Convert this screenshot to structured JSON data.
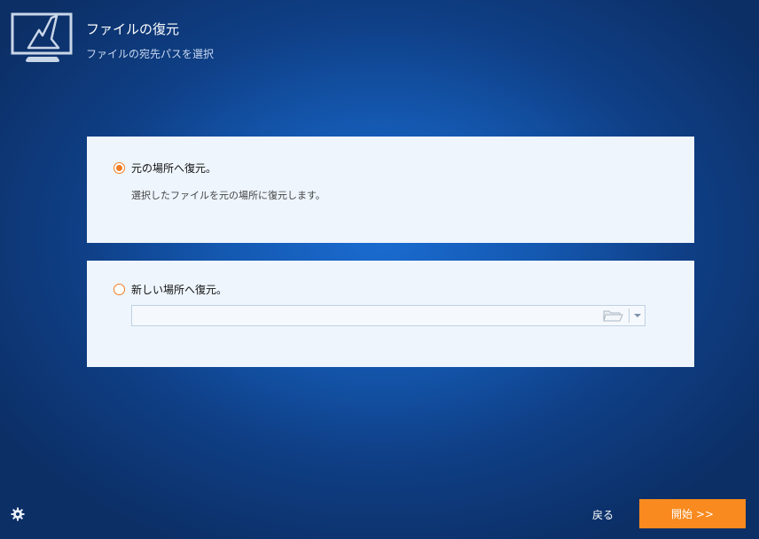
{
  "header": {
    "title": "ファイルの復元",
    "subtitle": "ファイルの宛先パスを選択",
    "logo_icon": "monitor-restore-icon"
  },
  "options": {
    "original": {
      "label": "元の場所へ復元。",
      "description": "選択したファイルを元の場所に復元します。",
      "selected": true
    },
    "new_location": {
      "label": "新しい場所へ復元。",
      "path_value": "",
      "selected": false,
      "browse_icon": "folder-open-icon",
      "dropdown_icon": "chevron-down-icon"
    }
  },
  "footer": {
    "settings_icon": "gear-icon",
    "back_label": "戻る",
    "start_label": "開始 >>"
  },
  "colors": {
    "accent": "#f88a1f",
    "radio": "#f07d22",
    "panel_bg": "#eef5fd",
    "background": "#1458b0"
  }
}
